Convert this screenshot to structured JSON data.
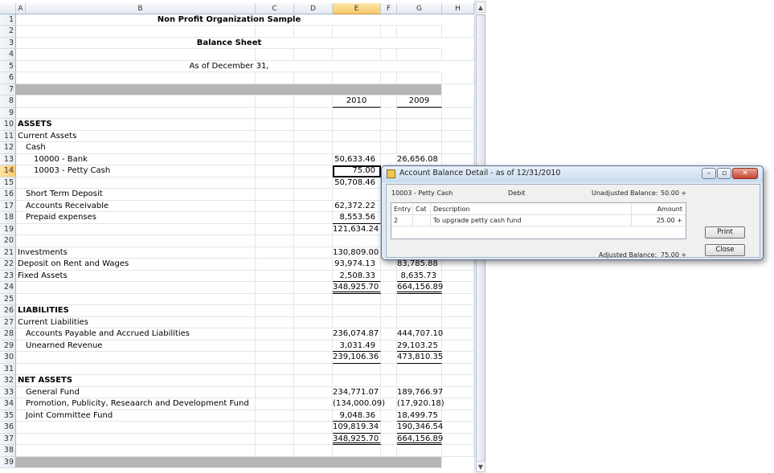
{
  "columns": [
    "A",
    "B",
    "C",
    "D",
    "E",
    "F",
    "G",
    "H"
  ],
  "rows": [
    {
      "n": "1",
      "b": "Non Profit Organization Sample",
      "center": true,
      "bold": true
    },
    {
      "n": "2"
    },
    {
      "n": "3",
      "b": "Balance Sheet",
      "center": true,
      "bold": true
    },
    {
      "n": "4"
    },
    {
      "n": "5",
      "b": "As of December 31,",
      "center": true
    },
    {
      "n": "6"
    },
    {
      "n": "7",
      "gray": true
    },
    {
      "n": "8",
      "e": "2010",
      "g": "2009",
      "ul": true,
      "center_nums": true
    },
    {
      "n": "9"
    },
    {
      "n": "10",
      "b": "ASSETS",
      "bold": true
    },
    {
      "n": "11",
      "b": "Current Assets"
    },
    {
      "n": "12",
      "b": "Cash",
      "indent": 1
    },
    {
      "n": "13",
      "b": "10000 - Bank",
      "indent": 2,
      "e": "50,633.46",
      "g": "26,656.08"
    },
    {
      "n": "14",
      "b": "10003 - Petty Cash",
      "indent": 2,
      "e": "75.00",
      "g": "",
      "sel": true,
      "ul": true
    },
    {
      "n": "15",
      "e": "50,708.46",
      "g": ""
    },
    {
      "n": "16",
      "b": "Short Term Deposit",
      "indent": 1
    },
    {
      "n": "17",
      "b": "Accounts Receivable",
      "indent": 1,
      "e": "62,372.22",
      "g": ""
    },
    {
      "n": "18",
      "b": "Prepaid expenses",
      "indent": 1,
      "e": "8,553.56",
      "g": "",
      "ul": true
    },
    {
      "n": "19",
      "e": "121,634.24",
      "g": ""
    },
    {
      "n": "20"
    },
    {
      "n": "21",
      "b": "Investments",
      "e": "130,809.00",
      "g": ""
    },
    {
      "n": "22",
      "b": "Deposit on Rent and Wages",
      "e": "93,974.13",
      "g": "83,785.88"
    },
    {
      "n": "23",
      "b": "Fixed Assets",
      "e": "2,508.33",
      "g": "8,635.73",
      "ul": true
    },
    {
      "n": "24",
      "e": "348,925.70",
      "g": "664,156.89",
      "dul": true
    },
    {
      "n": "25"
    },
    {
      "n": "26",
      "b": "LIABILITIES",
      "bold": true
    },
    {
      "n": "27",
      "b": "Current Liabilities"
    },
    {
      "n": "28",
      "b": "Accounts Payable and Accrued Liabilities",
      "indent": 1,
      "e": "236,074.87",
      "g": "444,707.10"
    },
    {
      "n": "29",
      "b": "Unearned Revenue",
      "indent": 1,
      "e": "3,031.49",
      "g": "29,103.25",
      "ul": true
    },
    {
      "n": "30",
      "e": "239,106.36",
      "g": "473,810.35",
      "ul": true
    },
    {
      "n": "31"
    },
    {
      "n": "32",
      "b": "NET ASSETS",
      "bold": true
    },
    {
      "n": "33",
      "b": "General Fund",
      "indent": 1,
      "e": "234,771.07",
      "g": "189,766.97"
    },
    {
      "n": "34",
      "b": "Promotion, Publicity, Reseaarch and Development Fund",
      "indent": 1,
      "e": "(134,000.09)",
      "g": "(17,920.18)"
    },
    {
      "n": "35",
      "b": "Joint Committee Fund",
      "indent": 1,
      "e": "9,048.36",
      "g": "18,499.75",
      "ul": true
    },
    {
      "n": "36",
      "e": "109,819.34",
      "g": "190,346.54",
      "ul": true
    },
    {
      "n": "37",
      "e": "348,925.70",
      "g": "664,156.89",
      "dul": true
    },
    {
      "n": "38"
    },
    {
      "n": "39",
      "gray": true
    }
  ],
  "dialog": {
    "title": "Account Balance Detail - as of 12/31/2010",
    "account": "10003 - Petty Cash",
    "type": "Debit",
    "unadjusted_label": "Unadjusted Balance:",
    "unadjusted_value": "50.00 +",
    "grid_headers": {
      "entry": "Entry",
      "cat": "Cat",
      "description": "Description",
      "amount": "Amount"
    },
    "grid_rows": [
      {
        "entry": "2",
        "cat": "",
        "description": "To upgrade petty cash fund",
        "amount": "25.00 +"
      }
    ],
    "adjusted_label": "Adjusted Balance:",
    "adjusted_value": "75.00 +",
    "print_label": "Print",
    "close_label": "Close",
    "min_glyph": "–",
    "max_glyph": "▫",
    "close_glyph": "✕"
  },
  "scrollbar": {
    "up_arrow": "▲",
    "down_arrow": "▼"
  }
}
